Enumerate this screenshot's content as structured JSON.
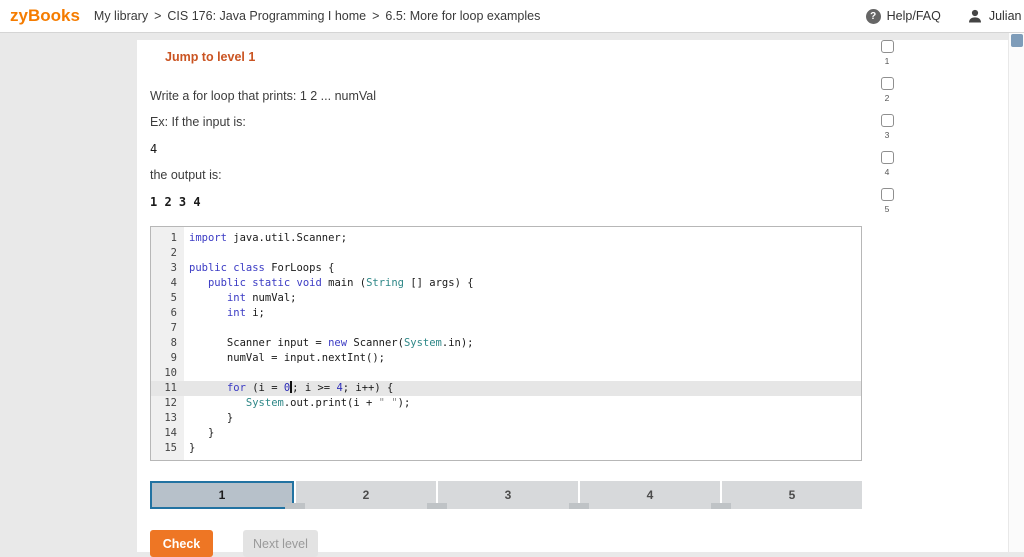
{
  "header": {
    "logo": "zyBooks",
    "breadcrumb": [
      "My library",
      "CIS 176: Java Programming I home",
      "6.5: More for loop examples"
    ],
    "separator": ">",
    "help_icon_glyph": "?",
    "help_label": "Help/FAQ",
    "user_name": "Julian N"
  },
  "activity": {
    "jump_link": "Jump to level 1",
    "prompt": "Write a for loop that prints: 1 2 ... numVal",
    "example_intro": "Ex: If the input is:",
    "example_input": "4",
    "output_intro": "the output is:",
    "example_output": "1 2 3 4",
    "check_button": "Check",
    "next_level_button": "Next level",
    "levels": [
      "1",
      "2",
      "3",
      "4",
      "5"
    ],
    "progress_segments": [
      {
        "label": "1",
        "active": true
      },
      {
        "label": "2",
        "active": false
      },
      {
        "label": "3",
        "active": false
      },
      {
        "label": "4",
        "active": false
      },
      {
        "label": "5",
        "active": false
      }
    ]
  },
  "editor": {
    "lines": [
      {
        "num": 1,
        "tokens": [
          {
            "t": "import",
            "c": "kw"
          },
          {
            "t": " java.util.Scanner;",
            "c": "pl"
          }
        ]
      },
      {
        "num": 2,
        "tokens": []
      },
      {
        "num": 3,
        "tokens": [
          {
            "t": "public",
            "c": "kw"
          },
          {
            "t": " ",
            "c": "pl"
          },
          {
            "t": "class",
            "c": "kw"
          },
          {
            "t": " ForLoops {",
            "c": "pl"
          }
        ]
      },
      {
        "num": 4,
        "tokens": [
          {
            "t": "   ",
            "c": "pl"
          },
          {
            "t": "public",
            "c": "kw"
          },
          {
            "t": " ",
            "c": "pl"
          },
          {
            "t": "static",
            "c": "kw"
          },
          {
            "t": " ",
            "c": "pl"
          },
          {
            "t": "void",
            "c": "kw"
          },
          {
            "t": " main (",
            "c": "pl"
          },
          {
            "t": "String",
            "c": "ty"
          },
          {
            "t": " [] args) {",
            "c": "pl"
          }
        ]
      },
      {
        "num": 5,
        "tokens": [
          {
            "t": "      ",
            "c": "pl"
          },
          {
            "t": "int",
            "c": "kw"
          },
          {
            "t": " numVal;",
            "c": "pl"
          }
        ]
      },
      {
        "num": 6,
        "tokens": [
          {
            "t": "      ",
            "c": "pl"
          },
          {
            "t": "int",
            "c": "kw"
          },
          {
            "t": " i;",
            "c": "pl"
          }
        ]
      },
      {
        "num": 7,
        "tokens": []
      },
      {
        "num": 8,
        "tokens": [
          {
            "t": "      Scanner input = ",
            "c": "pl"
          },
          {
            "t": "new",
            "c": "kw"
          },
          {
            "t": " Scanner(",
            "c": "pl"
          },
          {
            "t": "System",
            "c": "ty"
          },
          {
            "t": ".in);",
            "c": "pl"
          }
        ]
      },
      {
        "num": 9,
        "tokens": [
          {
            "t": "      numVal = input.nextInt();",
            "c": "pl"
          }
        ]
      },
      {
        "num": 10,
        "tokens": []
      },
      {
        "num": 11,
        "active": true,
        "tokens": [
          {
            "t": "      ",
            "c": "pl"
          },
          {
            "t": "for",
            "c": "kw"
          },
          {
            "t": " (i = ",
            "c": "pl"
          },
          {
            "t": "0",
            "c": "nu"
          },
          {
            "t": "",
            "c": "caret"
          },
          {
            "t": "; i >= ",
            "c": "pl"
          },
          {
            "t": "4",
            "c": "nu"
          },
          {
            "t": "; i++) {",
            "c": "pl"
          }
        ]
      },
      {
        "num": 12,
        "tokens": [
          {
            "t": "         ",
            "c": "pl"
          },
          {
            "t": "System",
            "c": "ty"
          },
          {
            "t": ".out.print(i + ",
            "c": "pl"
          },
          {
            "t": "\" \"",
            "c": "st"
          },
          {
            "t": ");",
            "c": "pl"
          }
        ]
      },
      {
        "num": 13,
        "tokens": [
          {
            "t": "      }",
            "c": "pl"
          }
        ]
      },
      {
        "num": 14,
        "tokens": [
          {
            "t": "   }",
            "c": "pl"
          }
        ]
      },
      {
        "num": 15,
        "tokens": [
          {
            "t": "}",
            "c": "pl"
          }
        ]
      }
    ]
  },
  "colors": {
    "brand_orange": "#f57c00",
    "jump_link": "#ca5422",
    "check_button": "#ee7624",
    "progress_active_border": "#2273a2",
    "progress_active_fill": "#b7c1ca",
    "syntax_keyword": "#3b3bc4",
    "syntax_type": "#2e8787",
    "syntax_number": "#2d2db8",
    "syntax_string": "#8c8c8c"
  }
}
